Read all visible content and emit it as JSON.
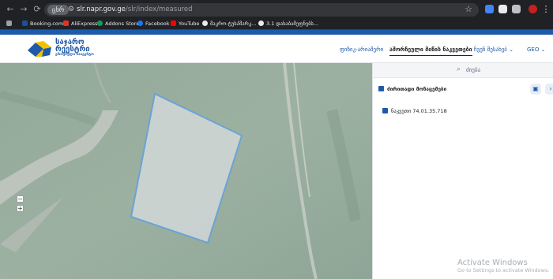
{
  "browser": {
    "url_chip": "ცხრ",
    "url_domain": "slr.napr.gov.ge",
    "url_path": "/slr/index/measured",
    "bookmarks": [
      "Booking.com",
      "AliExpress",
      "Addons Store",
      "Facebook",
      "YouTube",
      "მაკრო-ტუსპმარკ...",
      "3.1 დასაბამეფნებს..."
    ]
  },
  "header": {
    "logo_line1": "საჯარო",
    "logo_line2": "რეესტრი",
    "logo_sub": "ეროვნული სააგენტო",
    "menu": [
      "ფიზიკ-არიაშერი",
      "ამორჩეული მიწის ნაკვეთები",
      "ჩვენ შესახებ",
      "GEO"
    ]
  },
  "panel": {
    "search_placeholder": "ძიება",
    "row_title": "ძირითადი მონაცემები",
    "row_parcel": "ნაკვეთი 74.01.35.718"
  },
  "watermark": {
    "line1": "Activate Windows",
    "line2": "Go to Settings to activate Windows."
  },
  "colors": {
    "brand_blue": "#1e5aa8",
    "brand_yellow": "#f2c200",
    "parcel_fill": "#d9dde0",
    "parcel_stroke": "#6aa3d6"
  }
}
